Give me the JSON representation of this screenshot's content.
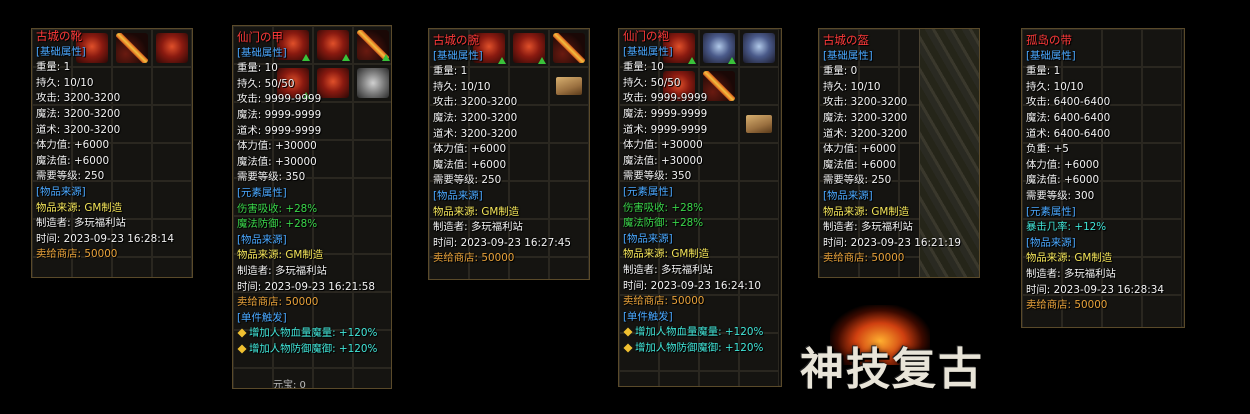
{
  "panels": [
    {
      "title": "古城の靴",
      "lines": [
        {
          "t": "[基础属性]",
          "c": "section"
        },
        {
          "t": "重量:    1",
          "c": "white"
        },
        {
          "t": "持久:  10/10",
          "c": "white"
        },
        {
          "t": "攻击:  3200-3200",
          "c": "white"
        },
        {
          "t": "魔法:  3200-3200",
          "c": "white"
        },
        {
          "t": "道术:  3200-3200",
          "c": "white"
        },
        {
          "t": "体力值:  +6000",
          "c": "white"
        },
        {
          "t": "魔法值:  +6000",
          "c": "white"
        },
        {
          "t": "需要等级:  250",
          "c": "white"
        },
        {
          "t": "[物品来源]",
          "c": "section"
        },
        {
          "t": "物品来源:  GM制造",
          "c": "yellow"
        },
        {
          "t": "制造者:  多玩福利站",
          "c": "white"
        },
        {
          "t": "时间:  2023-09-23  16:28:14",
          "c": "white"
        },
        {
          "t": "卖给商店:  50000",
          "c": "orange"
        }
      ],
      "icons": [
        "red",
        "sword",
        "red"
      ]
    },
    {
      "title": "仙门の甲",
      "lines": [
        {
          "t": "[基础属性]",
          "c": "section"
        },
        {
          "t": "重量:   10",
          "c": "white"
        },
        {
          "t": "持久:  50/50",
          "c": "white"
        },
        {
          "t": "攻击:  9999-9999",
          "c": "white"
        },
        {
          "t": "魔法:  9999-9999",
          "c": "white"
        },
        {
          "t": "道术:  9999-9999",
          "c": "white"
        },
        {
          "t": "体力值:  +30000",
          "c": "white"
        },
        {
          "t": "魔法值:  +30000",
          "c": "white"
        },
        {
          "t": "需要等级:  350",
          "c": "white"
        },
        {
          "t": "[元素属性]",
          "c": "section"
        },
        {
          "t": "伤害吸收:  +28%",
          "c": "green"
        },
        {
          "t": "魔法防御:  +28%",
          "c": "green"
        },
        {
          "t": "[物品来源]",
          "c": "section"
        },
        {
          "t": "物品来源:  GM制造",
          "c": "yellow"
        },
        {
          "t": "制造者:  多玩福利站",
          "c": "white"
        },
        {
          "t": "时间:  2023-09-23  16:21:58",
          "c": "white"
        },
        {
          "t": "卖给商店:  50000",
          "c": "orange"
        },
        {
          "t": "[单件触发]",
          "c": "section"
        },
        {
          "t": "增加人物血量魔量:  +120%",
          "c": "cyan",
          "gem": true
        },
        {
          "t": "增加人物防御魔御:  +120%",
          "c": "cyan",
          "gem": true
        }
      ],
      "icons": [
        "red",
        "red",
        "sword",
        "red",
        "red",
        "grey"
      ],
      "footer": "元宝:  0"
    },
    {
      "title": "古城の腕",
      "lines": [
        {
          "t": "[基础属性]",
          "c": "section"
        },
        {
          "t": "重量:    1",
          "c": "white"
        },
        {
          "t": "持久:  10/10",
          "c": "white"
        },
        {
          "t": "攻击:  3200-3200",
          "c": "white"
        },
        {
          "t": "魔法:  3200-3200",
          "c": "white"
        },
        {
          "t": "道术:  3200-3200",
          "c": "white"
        },
        {
          "t": "体力值:  +6000",
          "c": "white"
        },
        {
          "t": "魔法值:  +6000",
          "c": "white"
        },
        {
          "t": "需要等级:  250",
          "c": "white"
        },
        {
          "t": "[物品来源]",
          "c": "section"
        },
        {
          "t": "物品来源:  GM制造",
          "c": "yellow"
        },
        {
          "t": "制造者:  多玩福利站",
          "c": "white"
        },
        {
          "t": "时间:  2023-09-23  16:27:45",
          "c": "white"
        },
        {
          "t": "卖给商店:  50000",
          "c": "orange"
        }
      ],
      "icons": [
        "red",
        "red",
        "sword",
        "book"
      ]
    },
    {
      "title": "仙门の袍",
      "lines": [
        {
          "t": "[基础属性]",
          "c": "section"
        },
        {
          "t": "重量:   10",
          "c": "white"
        },
        {
          "t": "持久:  50/50",
          "c": "white"
        },
        {
          "t": "攻击:  9999-9999",
          "c": "white"
        },
        {
          "t": "魔法:  9999-9999",
          "c": "white"
        },
        {
          "t": "道术:  9999-9999",
          "c": "white"
        },
        {
          "t": "体力值:  +30000",
          "c": "white"
        },
        {
          "t": "魔法值:  +30000",
          "c": "white"
        },
        {
          "t": "需要等级:  350",
          "c": "white"
        },
        {
          "t": "[元素属性]",
          "c": "section"
        },
        {
          "t": "伤害吸收:  +28%",
          "c": "green"
        },
        {
          "t": "魔法防御:  +28%",
          "c": "green"
        },
        {
          "t": "[物品来源]",
          "c": "section"
        },
        {
          "t": "物品来源:  GM制造",
          "c": "yellow"
        },
        {
          "t": "制造者:  多玩福利站",
          "c": "white"
        },
        {
          "t": "时间:  2023-09-23  16:24:10",
          "c": "white"
        },
        {
          "t": "卖给商店:  50000",
          "c": "orange"
        },
        {
          "t": "[单件触发]",
          "c": "section"
        },
        {
          "t": "增加人物血量魔量:  +120%",
          "c": "cyan",
          "gem": true
        },
        {
          "t": "增加人物防御魔御:  +120%",
          "c": "cyan",
          "gem": true
        }
      ],
      "icons": [
        "red",
        "blue",
        "blue",
        "red",
        "sword",
        "book"
      ]
    },
    {
      "title": "古城の盔",
      "lines": [
        {
          "t": "[基础属性]",
          "c": "section"
        },
        {
          "t": "重量:    0",
          "c": "white"
        },
        {
          "t": "持久:  10/10",
          "c": "white"
        },
        {
          "t": "攻击:  3200-3200",
          "c": "white"
        },
        {
          "t": "魔法:  3200-3200",
          "c": "white"
        },
        {
          "t": "道术:  3200-3200",
          "c": "white"
        },
        {
          "t": "体力值:  +6000",
          "c": "white"
        },
        {
          "t": "魔法值:  +6000",
          "c": "white"
        },
        {
          "t": "需要等级:  250",
          "c": "white"
        },
        {
          "t": "[物品来源]",
          "c": "section"
        },
        {
          "t": "物品来源:  GM制造",
          "c": "yellow"
        },
        {
          "t": "制造者:  多玩福利站",
          "c": "white"
        },
        {
          "t": "时间:  2023-09-23  16:21:19",
          "c": "white"
        },
        {
          "t": "卖给商店:  50000",
          "c": "orange"
        }
      ],
      "icons": [
        "book"
      ]
    },
    {
      "title": "孤岛の带",
      "lines": [
        {
          "t": "[基础属性]",
          "c": "section"
        },
        {
          "t": "重量:    1",
          "c": "white"
        },
        {
          "t": "持久:  10/10",
          "c": "white"
        },
        {
          "t": "攻击:  6400-6400",
          "c": "white"
        },
        {
          "t": "魔法:  6400-6400",
          "c": "white"
        },
        {
          "t": "道术:  6400-6400",
          "c": "white"
        },
        {
          "t": "负重:  +5",
          "c": "white"
        },
        {
          "t": "体力值:  +6000",
          "c": "white"
        },
        {
          "t": "魔法值:  +6000",
          "c": "white"
        },
        {
          "t": "需要等级:  300",
          "c": "white"
        },
        {
          "t": "[元素属性]",
          "c": "section"
        },
        {
          "t": "暴击几率:  +12%",
          "c": "cyan"
        },
        {
          "t": "[物品来源]",
          "c": "section"
        },
        {
          "t": "物品来源:  GM制造",
          "c": "yellow"
        },
        {
          "t": "制造者:  多玩福利站",
          "c": "white"
        },
        {
          "t": "时间:  2023-09-23  16:28:34",
          "c": "white"
        },
        {
          "t": "卖给商店:  50000",
          "c": "orange"
        }
      ],
      "icons": []
    }
  ],
  "logo": "神技复古"
}
